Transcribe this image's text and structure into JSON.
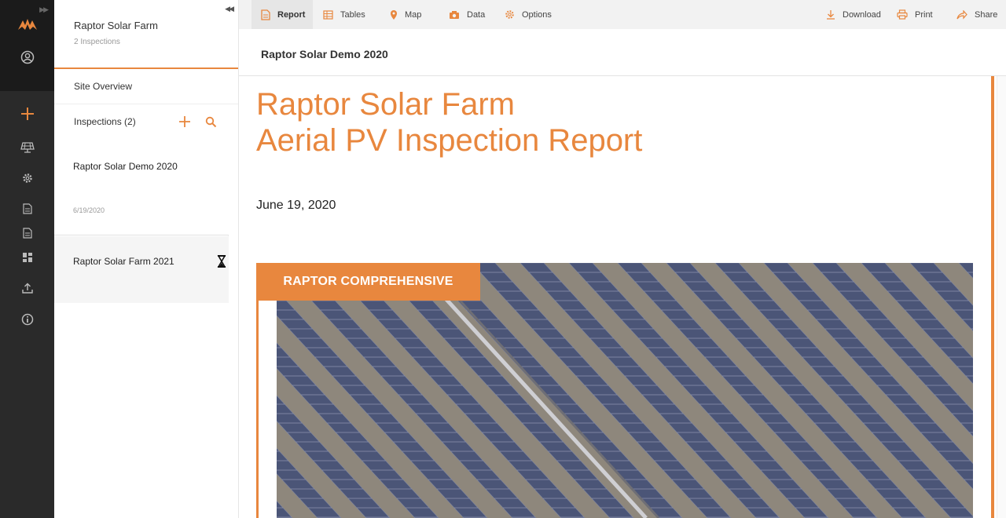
{
  "colors": {
    "accent": "#e8873e",
    "rail": "#2a2a2a"
  },
  "rail": {
    "icons": [
      "raptor-logo-icon",
      "user-circle-icon",
      "plus-icon",
      "solar-panel-icon",
      "gear-icon",
      "document-icon",
      "document-icon",
      "dashboard-icon",
      "upload-icon",
      "info-icon"
    ]
  },
  "sidebar": {
    "title": "Raptor Solar Farm",
    "subtitle": "2 Inspections",
    "site_overview": "Site Overview",
    "inspections_label": "Inspections (2)",
    "inspections": [
      {
        "name": "Raptor Solar Demo 2020",
        "date": "6/19/2020"
      },
      {
        "name": "Raptor Solar Farm 2021",
        "status_icon": "hourglass-icon"
      }
    ]
  },
  "toolbar": {
    "tabs": [
      {
        "label": "Report",
        "icon": "report-icon"
      },
      {
        "label": "Tables",
        "icon": "table-icon"
      },
      {
        "label": "Map",
        "icon": "map-pin-icon"
      },
      {
        "label": "Data",
        "icon": "camera-icon"
      },
      {
        "label": "Options",
        "icon": "gear-icon"
      }
    ],
    "actions": [
      {
        "label": "Download",
        "icon": "download-icon"
      },
      {
        "label": "Print",
        "icon": "print-icon"
      },
      {
        "label": "Share",
        "icon": "share-icon"
      }
    ]
  },
  "report": {
    "header": "Raptor Solar Demo 2020",
    "title_line1": "Raptor Solar Farm",
    "title_line2": "Aerial PV Inspection Report",
    "date": "June 19, 2020",
    "banner": "RAPTOR COMPREHENSIVE"
  }
}
